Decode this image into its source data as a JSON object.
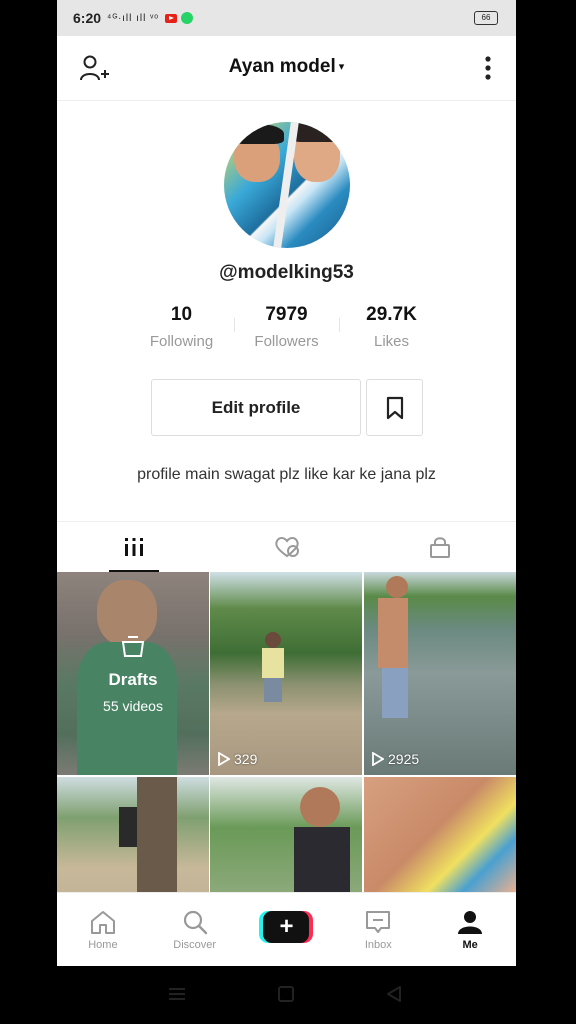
{
  "statusbar": {
    "time": "6:20",
    "signal": "⁴ᴳ∙ıll ıll ᵛᵒ",
    "battery": "66"
  },
  "header": {
    "title": "Ayan model",
    "caret": "▾"
  },
  "profile": {
    "username": "@modelking53",
    "stats": [
      {
        "value": "10",
        "label": "Following"
      },
      {
        "value": "7979",
        "label": "Followers"
      },
      {
        "value": "29.7K",
        "label": "Likes"
      }
    ],
    "edit_label": "Edit profile",
    "bio": "profile main swagat  plz like kar ke jana plz"
  },
  "tabs": [
    {
      "icon": "grid-icon",
      "active": true
    },
    {
      "icon": "liked-hidden-icon",
      "active": false
    },
    {
      "icon": "lock-icon",
      "active": false
    }
  ],
  "grid": {
    "drafts": {
      "label": "Drafts",
      "count": "55 videos"
    },
    "videos": [
      {
        "views": "329"
      },
      {
        "views": "2925"
      }
    ]
  },
  "bottomnav": [
    {
      "label": "Home",
      "icon": "home-icon"
    },
    {
      "label": "Discover",
      "icon": "search-icon"
    },
    {
      "label": "",
      "icon": "create-plus-icon"
    },
    {
      "label": "Inbox",
      "icon": "inbox-icon"
    },
    {
      "label": "Me",
      "icon": "profile-icon"
    }
  ]
}
